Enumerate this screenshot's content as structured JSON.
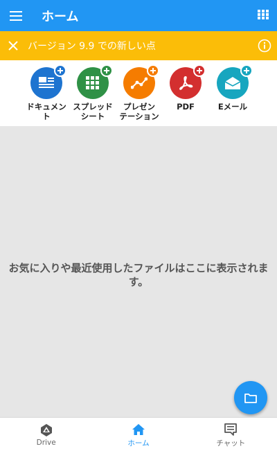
{
  "header": {
    "title": "ホーム",
    "menu_icon": "menu-icon",
    "apps_icon": "apps-grid-icon",
    "color": "#2196f3"
  },
  "banner": {
    "text": "バージョン 9.9 での新しい点",
    "close_icon": "close-icon",
    "info_icon": "info-icon",
    "color": "#fbbd08"
  },
  "create": {
    "items": [
      {
        "label": "ドキュメン\nト",
        "icon": "document-icon",
        "color": "#1e74d0"
      },
      {
        "label": "スプレッド\nシート",
        "icon": "spreadsheet-icon",
        "color": "#2f9146"
      },
      {
        "label": "プレゼン\nテーション",
        "icon": "presentation-icon",
        "color": "#f57c00"
      },
      {
        "label": "PDF",
        "icon": "pdf-icon",
        "color": "#d32f2f"
      },
      {
        "label": "Eメール",
        "icon": "email-icon",
        "color": "#17a6bf"
      }
    ]
  },
  "main": {
    "empty_message": "お気に入りや最近使用したファイルはここに表示されます。"
  },
  "fab": {
    "icon": "folder-icon"
  },
  "nav": {
    "items": [
      {
        "label": "Drive",
        "icon": "drive-icon",
        "active": false
      },
      {
        "label": "ホーム",
        "icon": "home-icon",
        "active": true
      },
      {
        "label": "チャット",
        "icon": "chat-icon",
        "active": false
      }
    ]
  }
}
